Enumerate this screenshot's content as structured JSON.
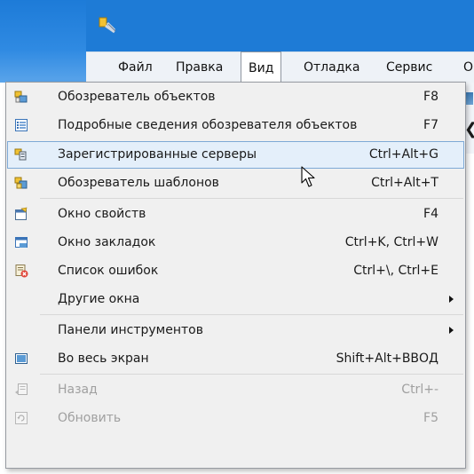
{
  "menubar": {
    "items": [
      {
        "label": "Файл"
      },
      {
        "label": "Правка"
      },
      {
        "label": "Вид"
      },
      {
        "label": "Отладка"
      },
      {
        "label": "Сервис"
      },
      {
        "label": "О"
      }
    ],
    "active_index": 2
  },
  "menu": {
    "items": [
      {
        "label": "Обозреватель объектов",
        "shortcut": "F8",
        "icon": "object-explorer-icon"
      },
      {
        "label": "Подробные сведения обозревателя объектов",
        "shortcut": "F7",
        "icon": "object-explorer-details-icon"
      },
      {
        "label": "Зарегистрированные серверы",
        "shortcut": "Ctrl+Alt+G",
        "icon": "registered-servers-icon",
        "highlighted": true
      },
      {
        "label": "Обозреватель шаблонов",
        "shortcut": "Ctrl+Alt+T",
        "icon": "template-explorer-icon"
      },
      {
        "label": "Окно свойств",
        "shortcut": "F4",
        "icon": "properties-window-icon"
      },
      {
        "label": "Окно закладок",
        "shortcut": "Ctrl+K, Ctrl+W",
        "icon": "bookmarks-window-icon"
      },
      {
        "label": "Список ошибок",
        "shortcut": "Ctrl+\\, Ctrl+E",
        "icon": "error-list-icon"
      },
      {
        "label": "Другие окна",
        "shortcut": "",
        "submenu": true
      },
      {
        "label": "Панели инструментов",
        "shortcut": "",
        "submenu": true
      },
      {
        "label": "Во весь экран",
        "shortcut": "Shift+Alt+ВВОД",
        "icon": "full-screen-icon"
      },
      {
        "label": "Назад",
        "shortcut": "Ctrl+-",
        "icon": "back-icon",
        "disabled": true
      },
      {
        "label": "Обновить",
        "shortcut": "F5",
        "icon": "refresh-icon",
        "disabled": true
      }
    ]
  },
  "colors": {
    "titlebar": "#1e7bd6",
    "menu_bg": "#f0f0f0",
    "highlight_bg": "#e4effa",
    "highlight_border": "#7ea9d6",
    "disabled_text": "#a0a0a0"
  }
}
